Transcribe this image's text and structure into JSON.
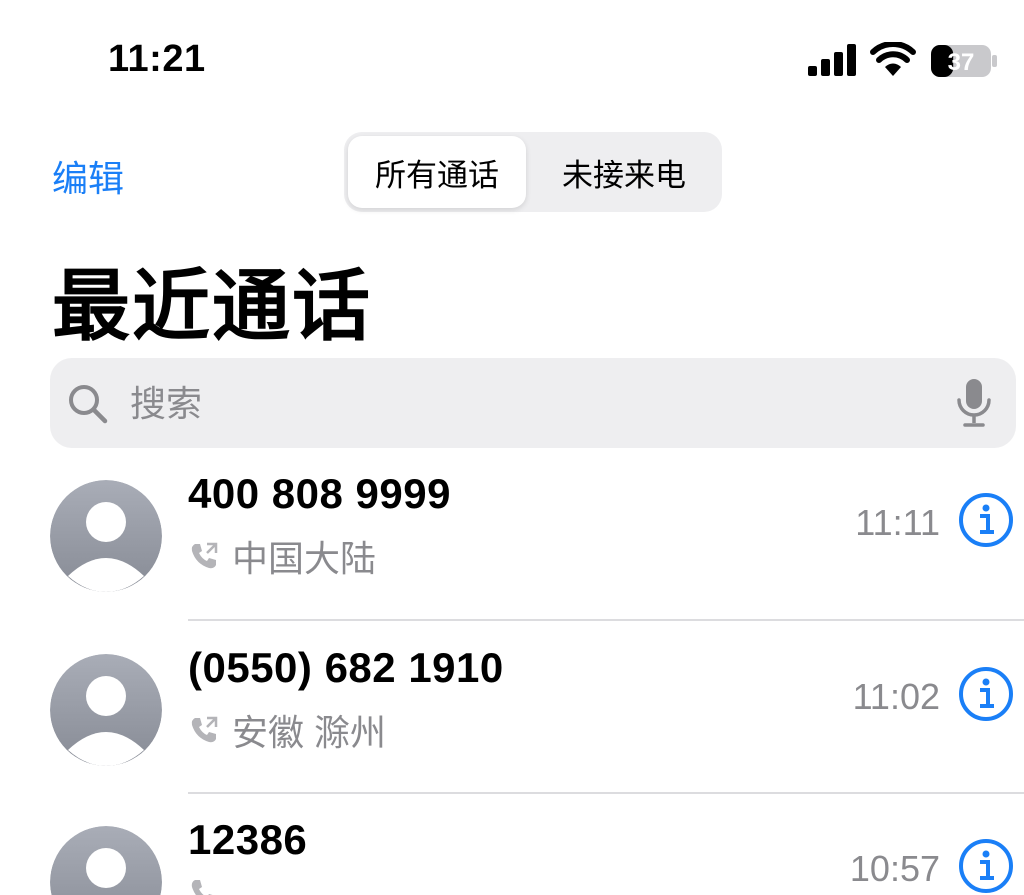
{
  "status_bar": {
    "time": "11:21",
    "battery_level": "37",
    "battery_percent": 37
  },
  "header": {
    "edit_label": "编辑",
    "segments": [
      "所有通话",
      "未接来电"
    ],
    "selected_segment": "所有通话",
    "title": "最近通话"
  },
  "search": {
    "placeholder": "搜索",
    "value": ""
  },
  "calls": [
    {
      "number": "400 808 9999",
      "location": "中国大陆",
      "time": "11:11"
    },
    {
      "number": "(0550) 682 1910",
      "location": "安徽 滁州",
      "time": "11:02"
    },
    {
      "number": "12386",
      "location": "",
      "time": "10:57"
    }
  ],
  "colors": {
    "accent": "#1a7ff7",
    "secondary_text": "#8a8a8e",
    "avatar_gradient_top": "#a9adb7",
    "avatar_gradient_bottom": "#878b95"
  }
}
